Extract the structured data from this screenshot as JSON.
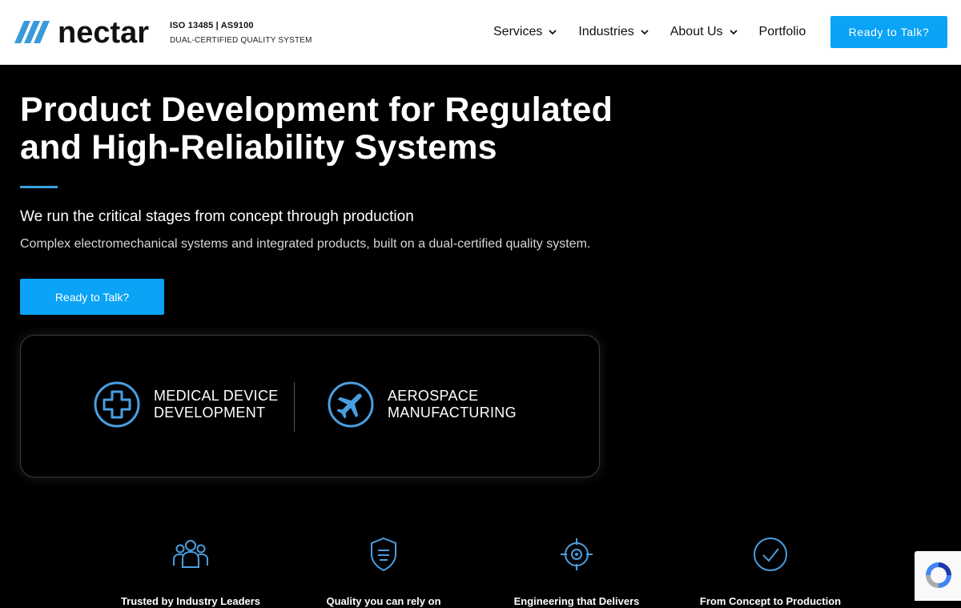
{
  "header": {
    "logo_text": "nectar",
    "cert_title": "ISO 13485 | AS9100",
    "cert_subtitle": "DUAL-CERTIFIED QUALITY SYSTEM",
    "nav": [
      {
        "label": "Services",
        "has_dropdown": true
      },
      {
        "label": "Industries",
        "has_dropdown": true
      },
      {
        "label": "About Us",
        "has_dropdown": true
      },
      {
        "label": "Portfolio",
        "has_dropdown": false
      }
    ],
    "cta_label": "Ready to Talk?"
  },
  "hero": {
    "title_line1": "Product Development for Regulated",
    "title_line2": "and High-Reliability Systems",
    "subtitle": "We run the critical stages from concept through production",
    "description": "Complex electromechanical systems and integrated products, built on a dual-certified quality system.",
    "cta_label": "Ready to Talk?"
  },
  "industries": [
    {
      "line1": "MEDICAL DEVICE",
      "line2": "DEVELOPMENT",
      "icon": "medical-cross-icon"
    },
    {
      "line1": "AEROSPACE",
      "line2": "MANUFACTURING",
      "icon": "airplane-icon"
    }
  ],
  "features": [
    {
      "title": "Trusted by Industry Leaders",
      "icon": "people-group-icon"
    },
    {
      "title": "Quality you can rely on",
      "icon": "shield-icon"
    },
    {
      "title": "Engineering that Delivers",
      "icon": "target-crosshair-icon"
    },
    {
      "title": "From Concept to Production",
      "icon": "check-circle-icon"
    }
  ],
  "colors": {
    "accent": "#0aa3f5",
    "icon_blue": "#4a9ee0",
    "background": "#000000",
    "header_bg": "#ffffff"
  }
}
